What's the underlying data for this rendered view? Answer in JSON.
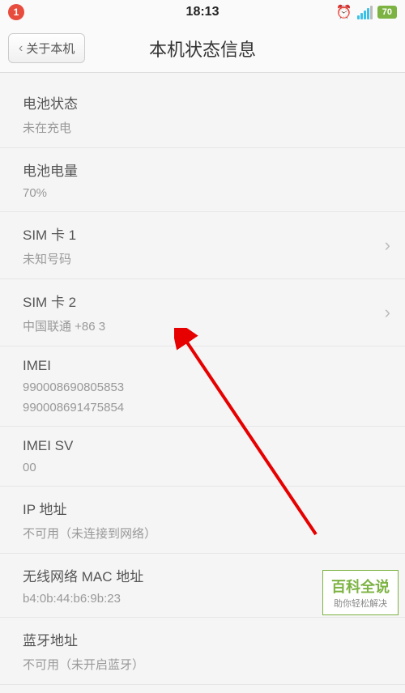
{
  "status": {
    "notif_count": "1",
    "time": "18:13",
    "battery": "70"
  },
  "nav": {
    "back_label": "关于本机",
    "title": "本机状态信息"
  },
  "rows": {
    "battery_status": {
      "title": "电池状态",
      "value": "未在充电"
    },
    "battery_level": {
      "title": "电池电量",
      "value": "70%"
    },
    "sim1": {
      "title": "SIM 卡 1",
      "value": "未知号码"
    },
    "sim2": {
      "title": "SIM 卡 2",
      "value": "中国联通 +86               3"
    },
    "imei": {
      "title": "IMEI",
      "value1": "990008690805853",
      "value2": "990008691475854"
    },
    "imei_sv": {
      "title": "IMEI SV",
      "value": "00"
    },
    "ip": {
      "title": "IP 地址",
      "value": "不可用（未连接到网络）"
    },
    "mac": {
      "title": "无线网络 MAC 地址",
      "value": "b4:0b:44:b6:9b:23"
    },
    "bt": {
      "title": "蓝牙地址",
      "value": "不可用（未开启蓝牙）"
    }
  },
  "watermark": {
    "title": "百科全说",
    "sub": "助你轻松解决"
  }
}
